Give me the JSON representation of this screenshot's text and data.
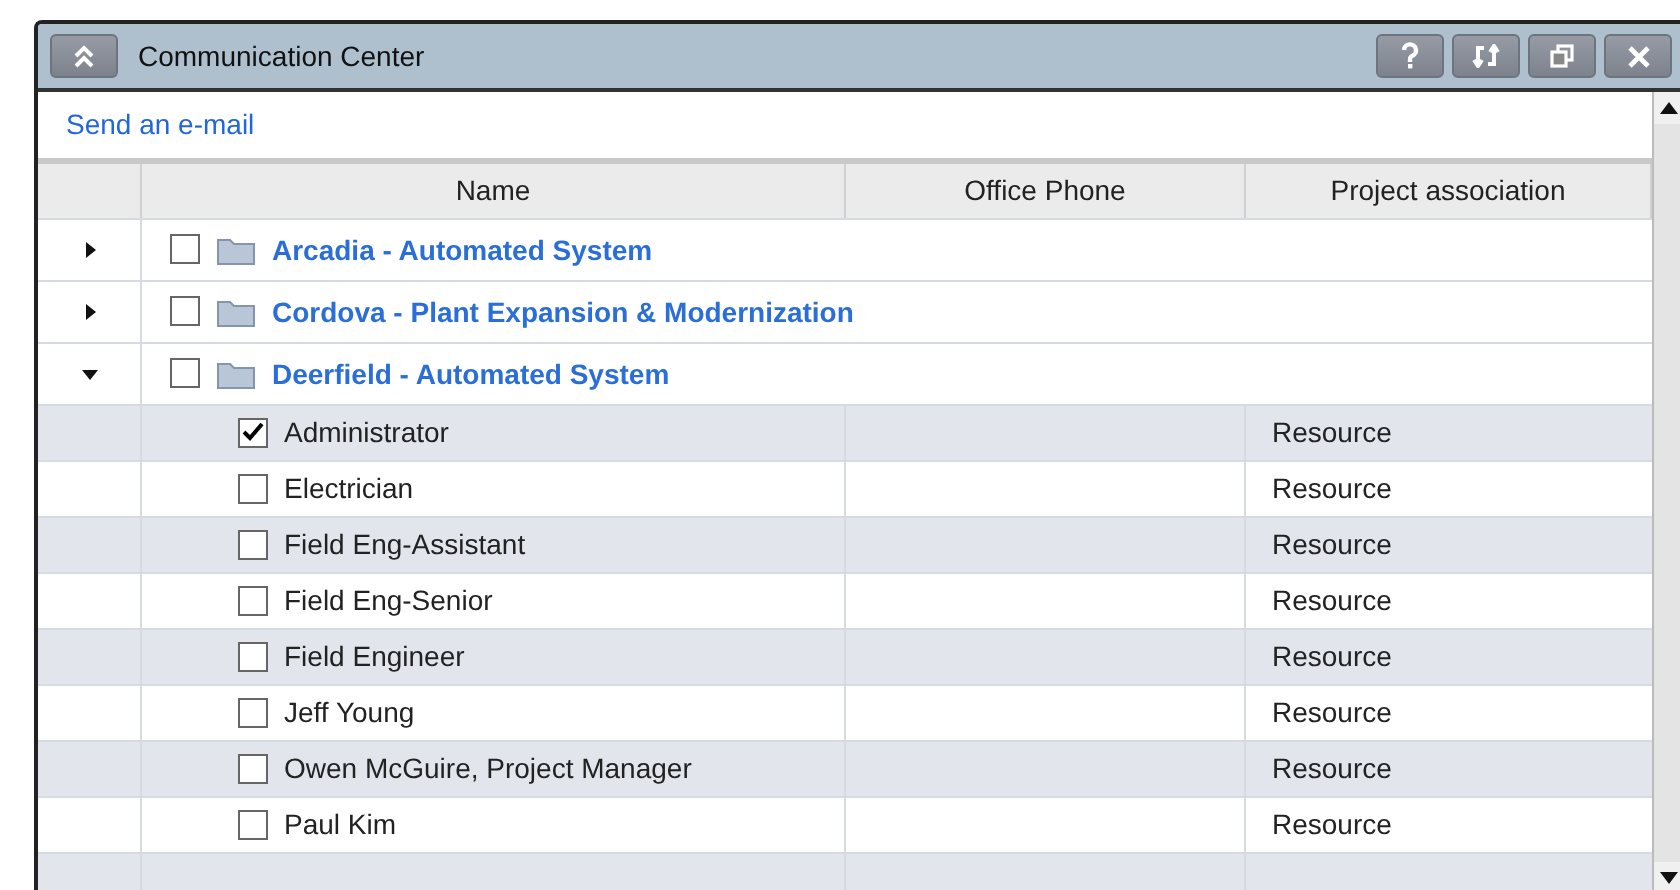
{
  "window": {
    "title": "Communication Center"
  },
  "link": "Send an e-mail",
  "table": {
    "columns": [
      "Name",
      "Office Phone",
      "Project association"
    ],
    "groups": [
      {
        "name": "Arcadia - Automated System",
        "expanded": false,
        "checked": false
      },
      {
        "name": "Cordova - Plant Expansion & Modernization",
        "expanded": false,
        "checked": false
      },
      {
        "name": "Deerfield - Automated System",
        "expanded": true,
        "checked": false,
        "members": [
          {
            "name": "Administrator",
            "checked": true,
            "project": "Resource"
          },
          {
            "name": "Electrician",
            "checked": false,
            "project": "Resource"
          },
          {
            "name": "Field Eng-Assistant",
            "checked": false,
            "project": "Resource"
          },
          {
            "name": "Field Eng-Senior",
            "checked": false,
            "project": "Resource"
          },
          {
            "name": "Field Engineer",
            "checked": false,
            "project": "Resource"
          },
          {
            "name": "Jeff Young",
            "checked": false,
            "project": "Resource"
          },
          {
            "name": "Owen McGuire, Project Manager",
            "checked": false,
            "project": "Resource"
          },
          {
            "name": "Paul Kim",
            "checked": false,
            "project": "Resource"
          }
        ]
      }
    ]
  }
}
